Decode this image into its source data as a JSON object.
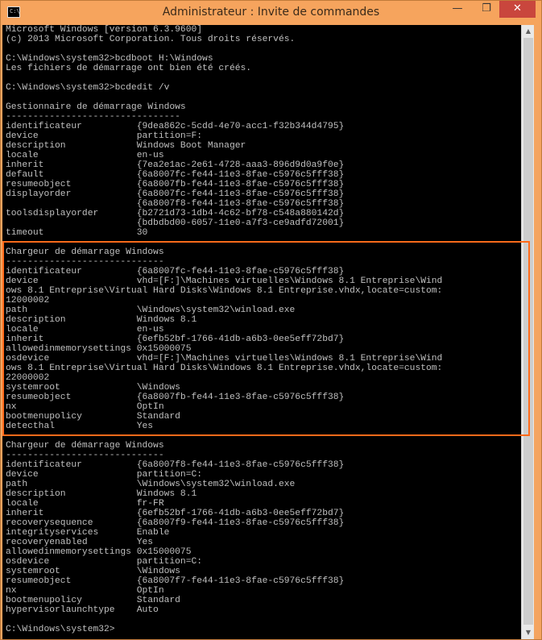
{
  "window": {
    "title": "Administrateur : Invite de commandes",
    "icon_label": "C:\\",
    "minimize_glyph": "—",
    "maximize_glyph": "❐",
    "close_glyph": "✕"
  },
  "scrollbar": {
    "up_glyph": "▲",
    "down_glyph": "▼"
  },
  "console": {
    "text": "Microsoft Windows [version 6.3.9600]\n(c) 2013 Microsoft Corporation. Tous droits réservés.\n\nC:\\Windows\\system32>bcdboot H:\\Windows\nLes fichiers de démarrage ont bien été créés.\n\nC:\\Windows\\system32>bcdedit /v\n\nGestionnaire de démarrage Windows\n--------------------------------\nidentificateur          {9dea862c-5cdd-4e70-acc1-f32b344d4795}\ndevice                  partition=F:\ndescription             Windows Boot Manager\nlocale                  en-us\ninherit                 {7ea2e1ac-2e61-4728-aaa3-896d9d0a9f0e}\ndefault                 {6a8007fc-fe44-11e3-8fae-c5976c5fff38}\nresumeobject            {6a8007fb-fe44-11e3-8fae-c5976c5fff38}\ndisplayorder            {6a8007fc-fe44-11e3-8fae-c5976c5fff38}\n                        {6a8007f8-fe44-11e3-8fae-c5976c5fff38}\ntoolsdisplayorder       {b2721d73-1db4-4c62-bf78-c548a880142d}\n                        {bdbdbd00-6057-11e0-a7f3-ce9adfd72001}\ntimeout                 30\n\nChargeur de démarrage Windows\n-----------------------------\nidentificateur          {6a8007fc-fe44-11e3-8fae-c5976c5fff38}\ndevice                  vhd=[F:]\\Machines virtuelles\\Windows 8.1 Entreprise\\Wind\nows 8.1 Entreprise\\Virtual Hard Disks\\Windows 8.1 Entreprise.vhdx,locate=custom:\n12000002\npath                    \\Windows\\system32\\winload.exe\ndescription             Windows 8.1\nlocale                  en-us\ninherit                 {6efb52bf-1766-41db-a6b3-0ee5eff72bd7}\nallowedinmemorysettings 0x15000075\nosdevice                vhd=[F:]\\Machines virtuelles\\Windows 8.1 Entreprise\\Wind\nows 8.1 Entreprise\\Virtual Hard Disks\\Windows 8.1 Entreprise.vhdx,locate=custom:\n22000002\nsystemroot              \\Windows\nresumeobject            {6a8007fb-fe44-11e3-8fae-c5976c5fff38}\nnx                      OptIn\nbootmenupolicy          Standard\ndetecthal               Yes\n\nChargeur de démarrage Windows\n-----------------------------\nidentificateur          {6a8007f8-fe44-11e3-8fae-c5976c5fff38}\ndevice                  partition=C:\npath                    \\Windows\\system32\\winload.exe\ndescription             Windows 8.1\nlocale                  fr-FR\ninherit                 {6efb52bf-1766-41db-a6b3-0ee5eff72bd7}\nrecoverysequence        {6a8007f9-fe44-11e3-8fae-c5976c5fff38}\nintegrityservices       Enable\nrecoveryenabled         Yes\nallowedinmemorysettings 0x15000075\nosdevice                partition=C:\nsystemroot              \\Windows\nresumeobject            {6a8007f7-fe44-11e3-8fae-c5976c5fff38}\nnx                      OptIn\nbootmenupolicy          Standard\nhypervisorlaunchtype    Auto\n\nC:\\Windows\\system32>"
  },
  "colors": {
    "titlebar": "#f6a45d",
    "console_bg": "#000000",
    "console_fg": "#c0c0c0",
    "highlight": "#ff6a1a",
    "close_button": "#c9463d"
  }
}
